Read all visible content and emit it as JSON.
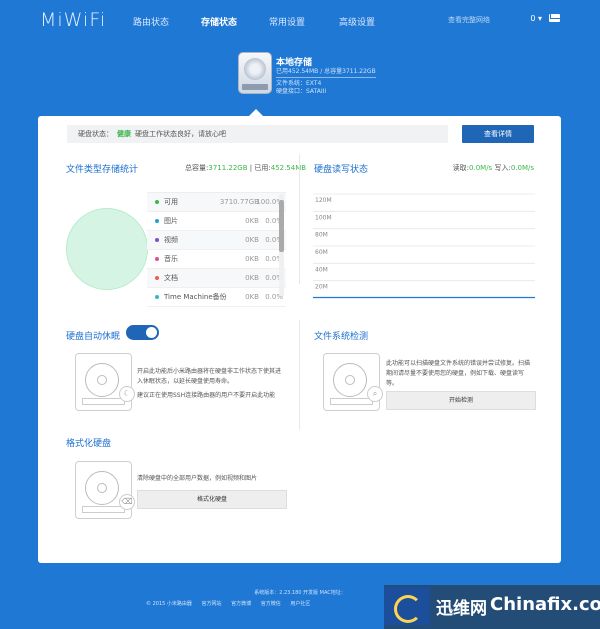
{
  "header": {
    "logo": "MiWiFi",
    "nav": [
      {
        "label": "路由状态",
        "active": false
      },
      {
        "label": "存储状态",
        "active": true
      },
      {
        "label": "常用设置",
        "active": false
      },
      {
        "label": "高级设置",
        "active": false
      }
    ],
    "network_label": "查看完整网络",
    "dropdown_label": "0 ▾"
  },
  "disk": {
    "title": "本地存储",
    "usage": "已用452.54MB / 总容量3711.22GB",
    "filesystem": "文件系统：EXT4",
    "port": "硬盘接口：SATAIII"
  },
  "status_bar": {
    "label": "硬盘状态：",
    "status": "健康",
    "message": "硬盘工作状态良好，请放心吧",
    "detail_button": "查看详情"
  },
  "file_stats": {
    "title": "文件类型存储统计",
    "total_label": "总容量:",
    "total_value": "3711.22GB",
    "separator": " | ",
    "used_label": "已用:",
    "used_value": "452.54MB",
    "items": [
      {
        "name": "可用",
        "size": "3710.77GB",
        "pct": "100.0%",
        "color": "#3eb64a"
      },
      {
        "name": "图片",
        "size": "0KB",
        "pct": "0.0%",
        "color": "#1ba1e2"
      },
      {
        "name": "视频",
        "size": "0KB",
        "pct": "0.0%",
        "color": "#7b4fd1"
      },
      {
        "name": "音乐",
        "size": "0KB",
        "pct": "0.0%",
        "color": "#e0508e"
      },
      {
        "name": "文档",
        "size": "0KB",
        "pct": "0.0%",
        "color": "#f05a5a"
      },
      {
        "name": "Time Machine备份",
        "size": "0KB",
        "pct": "0.0%",
        "color": "#2dbcc6"
      }
    ]
  },
  "rw_status": {
    "title": "硬盘读写状态",
    "read_label": "读取:",
    "read_value": "0.0M/s",
    "write_label": "写入:",
    "write_value": "0.0M/s"
  },
  "chart_data": {
    "type": "area",
    "title": "",
    "xlabel": "",
    "ylabel": "",
    "ylim": [
      0,
      120
    ],
    "yticks": [
      "120M",
      "100M",
      "80M",
      "60M",
      "40M",
      "20M"
    ],
    "series": [
      {
        "values": [
          0,
          0,
          0,
          0,
          0,
          0,
          0,
          0,
          0,
          0
        ]
      }
    ],
    "grid": true
  },
  "sleep": {
    "title": "硬盘自动休眠",
    "enabled": true,
    "desc1": "开启此功能后小米路由器将在硬盘非工作状态下使其进入休眠状态，以延长硬盘使用寿命。",
    "desc2": "建议正在使用SSH连接路由器的用户不要开启此功能"
  },
  "fscheck": {
    "title": "文件系统检测",
    "desc": "此功能可以扫描硬盘文件系统的错误并尝试修复。扫描期间请尽量不要使用您的硬盘，例如下载、硬盘读写等。",
    "button": "开始检测"
  },
  "format": {
    "title": "格式化硬盘",
    "desc": "清除硬盘中的全部用户数据，例如视频和图片",
    "button": "格式化硬盘"
  },
  "footer": {
    "version": "系统版本：2.23.180 开发版  MAC地址：",
    "copyright": "© 2015 小米路由器",
    "links": [
      "官方网站",
      "官方微博",
      "官方微信",
      "用户社区"
    ]
  },
  "watermark": {
    "cn": "迅维网",
    "en": "Chinafix.com"
  }
}
